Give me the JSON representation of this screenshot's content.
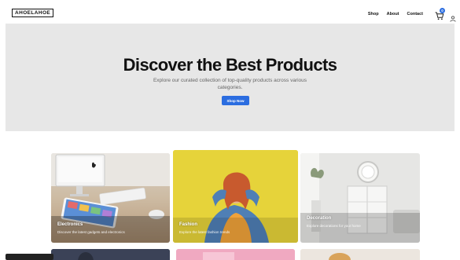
{
  "header": {
    "logo": "AHOELAHOE",
    "nav": [
      "Shop",
      "About",
      "Contact"
    ],
    "cart_count": "0"
  },
  "hero": {
    "title": "Discover the Best Products",
    "subtitle": "Explore our curated collection of top-quality products across various categories.",
    "cta": "Shop Now"
  },
  "categories": [
    {
      "label": "Electronics",
      "description": "Discover the latest gadgets and electronics"
    },
    {
      "label": "Fashion",
      "description": "Explore the latest fashion trends"
    },
    {
      "label": "Decoration",
      "description": "Explore decorations for your home"
    }
  ],
  "colors": {
    "accent": "#2b6de0",
    "hero_bg": "#e7e7e7"
  },
  "icons": {
    "cart": "cart-icon",
    "user": "user-icon"
  }
}
